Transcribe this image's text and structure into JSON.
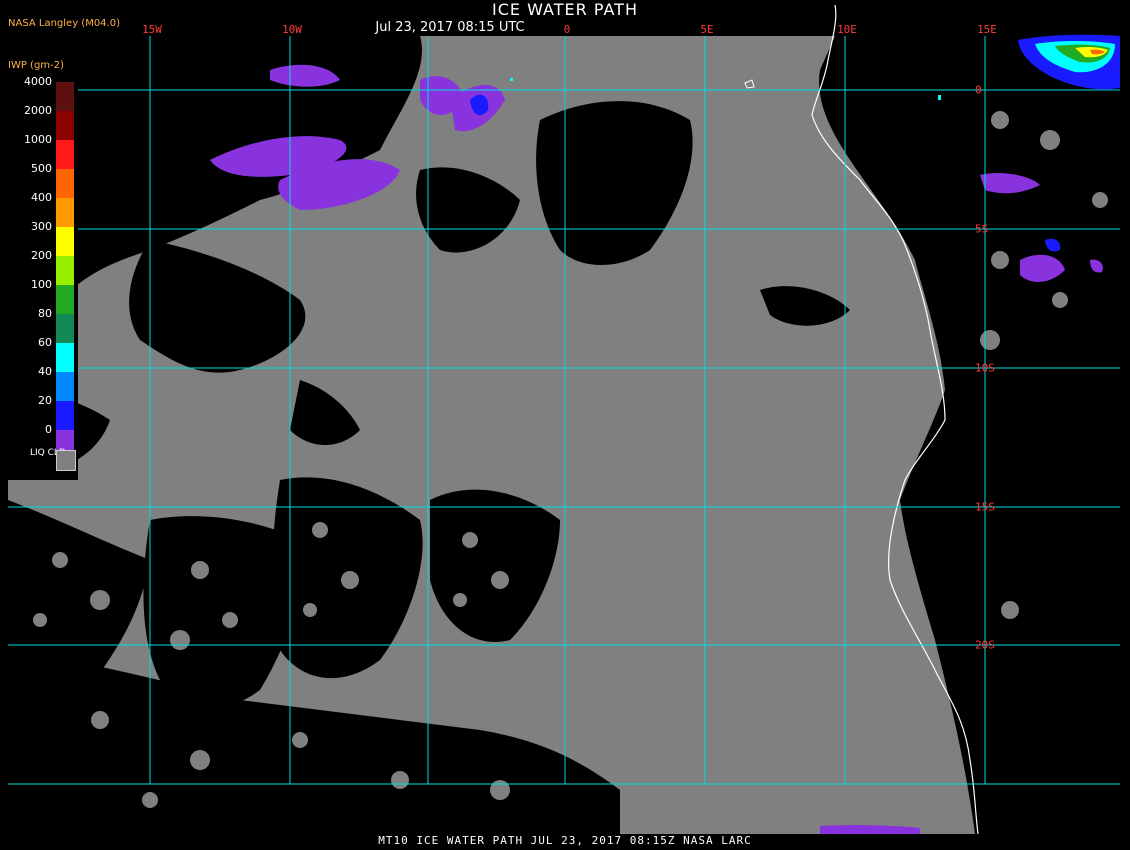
{
  "header": {
    "title": "ICE WATER PATH",
    "timestamp": "Jul 23, 2017 08:15 UTC",
    "credit": "NASA Langley (M04.0)"
  },
  "legend": {
    "title": "IWP (gm-2)",
    "steps": [
      {
        "label": "4000",
        "color": "#5c1010"
      },
      {
        "label": "2000",
        "color": "#8b0000"
      },
      {
        "label": "1000",
        "color": "#ff1a1a"
      },
      {
        "label": "500",
        "color": "#ff6600"
      },
      {
        "label": "400",
        "color": "#ff9900"
      },
      {
        "label": "300",
        "color": "#ffff00"
      },
      {
        "label": "200",
        "color": "#99ee00"
      },
      {
        "label": "100",
        "color": "#22aa22"
      },
      {
        "label": "80",
        "color": "#118855"
      },
      {
        "label": "60",
        "color": "#00ffff"
      },
      {
        "label": "40",
        "color": "#0088ff"
      },
      {
        "label": "20",
        "color": "#1a1aff"
      },
      {
        "label": "0",
        "color": "#8833dd"
      }
    ],
    "liquid_label": "LIQ CLD",
    "liquid_color": "#808080"
  },
  "grid": {
    "longitudes": [
      "15W",
      "10W",
      "0",
      "5E",
      "10E",
      "15E"
    ],
    "latitudes": [
      "0",
      "5S",
      "10S",
      "15S",
      "20S"
    ],
    "color": "#00dddd"
  },
  "footer": "MT10  ICE WATER PATH   JUL 23, 2017 08:15Z   NASA LARC"
}
